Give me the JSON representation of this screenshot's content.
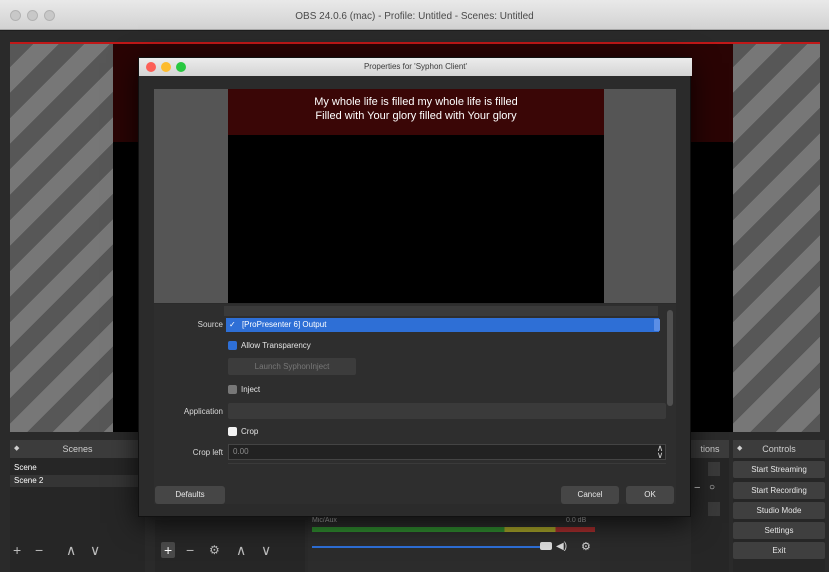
{
  "window": {
    "title": "OBS 24.0.6 (mac) - Profile: Untitled - Scenes: Untitled"
  },
  "dialog": {
    "title": "Properties for 'Syphon Client'",
    "lyrics_line1": "My whole life is filled my whole life is filled",
    "lyrics_line2": "Filled with Your glory filled with Your glory",
    "source_label": "Source",
    "source_value": "[ProPresenter 6] Output",
    "allow_transparency_label": "Allow Transparency",
    "launch_button": "Launch SyphonInject",
    "inject_label": "Inject",
    "application_label": "Application",
    "crop_label": "Crop",
    "crop_left_label": "Crop left",
    "crop_left_value": "0.00",
    "defaults_button": "Defaults",
    "cancel_button": "Cancel",
    "ok_button": "OK"
  },
  "scenes": {
    "header": "Scenes",
    "items": [
      "Scene",
      "Scene 2"
    ]
  },
  "audio": {
    "channel": "Mic/Aux",
    "level": "0.0 dB"
  },
  "transitions": {
    "header_partial": "tions"
  },
  "controls": {
    "header": "Controls",
    "buttons": [
      "Start Streaming",
      "Start Recording",
      "Studio Mode",
      "Settings",
      "Exit"
    ]
  },
  "icons": {
    "add": "+",
    "remove": "−",
    "up": "∧",
    "down": "∨",
    "gear": "⚙",
    "check": "✓"
  },
  "colors": {
    "accent": "#2e6fd6",
    "stripe_light": "#777777",
    "stripe_dark": "#575757"
  }
}
